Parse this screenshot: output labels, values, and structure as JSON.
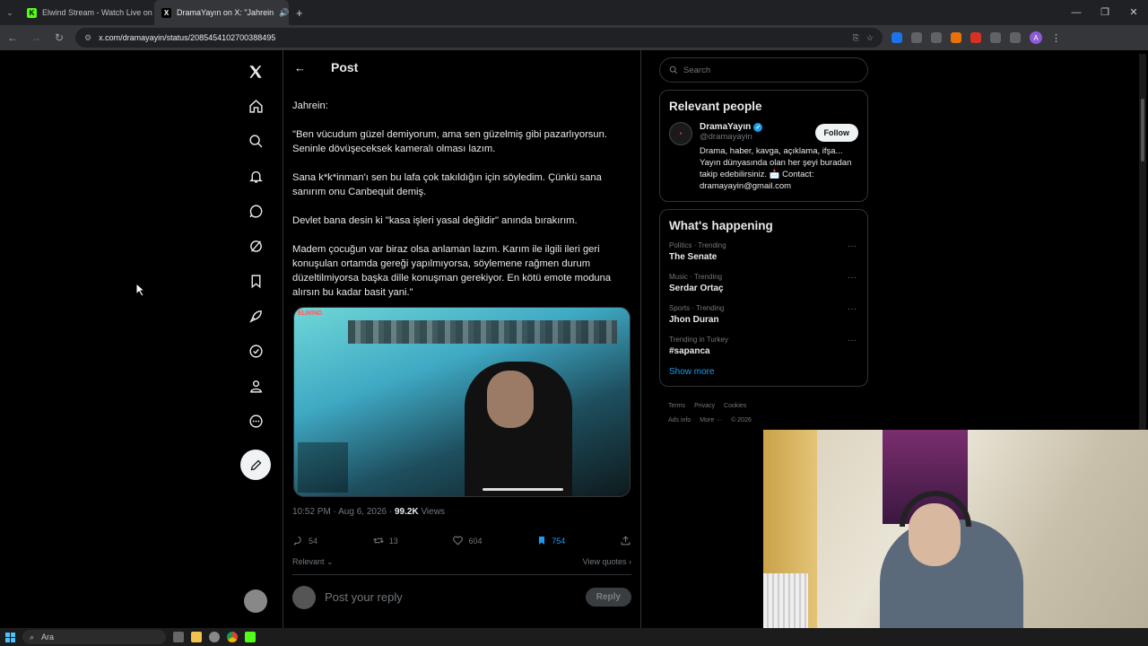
{
  "browser": {
    "tabs": [
      {
        "label": "Elwind Stream - Watch Live on",
        "favicon": "K"
      },
      {
        "label": "DramaYayın on X: \"Jahrein",
        "favicon": "X"
      }
    ],
    "url": "x.com/dramayayin/status/2085454102700388495",
    "profile_initial": "A"
  },
  "post": {
    "header_title": "Post",
    "paragraphs": [
      "Jahrein:",
      "\"Ben vücudum güzel demiyorum, ama sen güzelmiş gibi pazarlıyorsun. Seninle dövüşeceksek kameralı olması lazım.",
      "Sana k*k*inman'ı sen bu lafa çok takıldığın için söyledim. Çünkü sana sanırım onu Canbequit demiş.",
      "Devlet bana desin ki \"kasa işleri yasal değildir\" anında bırakırım.",
      "Madem çocuğun var biraz olsa anlaman lazım. Karım ile ilgili ileri geri konuşulan ortamda gereği yapılmıyorsa, söylemene rağmen durum düzeltilmiyorsa başka dille konuşman gerekiyor. En kötü emote moduna alırsın bu kadar basit yani.\""
    ],
    "media_watermark": "ELWIND",
    "time": "10:52 PM · Aug 6, 2026",
    "views_count": "99.2K",
    "views_label": "Views",
    "replies": "54",
    "reposts": "13",
    "likes": "604",
    "bookmarks": "754",
    "sort_label": "Relevant",
    "view_quotes": "View quotes",
    "reply_placeholder": "Post your reply",
    "reply_button": "Reply"
  },
  "sidebar": {
    "search_placeholder": "Search",
    "relevant_title": "Relevant people",
    "person": {
      "name": "DramaYayın",
      "handle": "@dramayayin",
      "bio": "Drama, haber, kavga, açıklama, ifşa... Yayın dünyasında olan her şeyi buradan takip edebilirsiniz. 📩 Contact: dramayayin@gmail.com",
      "follow_label": "Follow"
    },
    "happening_title": "What's happening",
    "trends": [
      {
        "meta": "Politics · Trending",
        "name": "The Senate"
      },
      {
        "meta": "Music · Trending",
        "name": "Serdar Ortaç"
      },
      {
        "meta": "Sports · Trending",
        "name": "Jhon Duran"
      },
      {
        "meta": "Trending in Turkey",
        "name": "#sapanca"
      }
    ],
    "show_more": "Show more",
    "footer": [
      "Terms",
      "Privacy",
      "Cookies",
      "Ads info",
      "More ···",
      "© 2026"
    ]
  },
  "taskbar": {
    "search_label": "Ara"
  },
  "colors": {
    "accent": "#1d9bf0",
    "background": "#000000",
    "border": "#2f3336",
    "muted": "#71767b"
  }
}
